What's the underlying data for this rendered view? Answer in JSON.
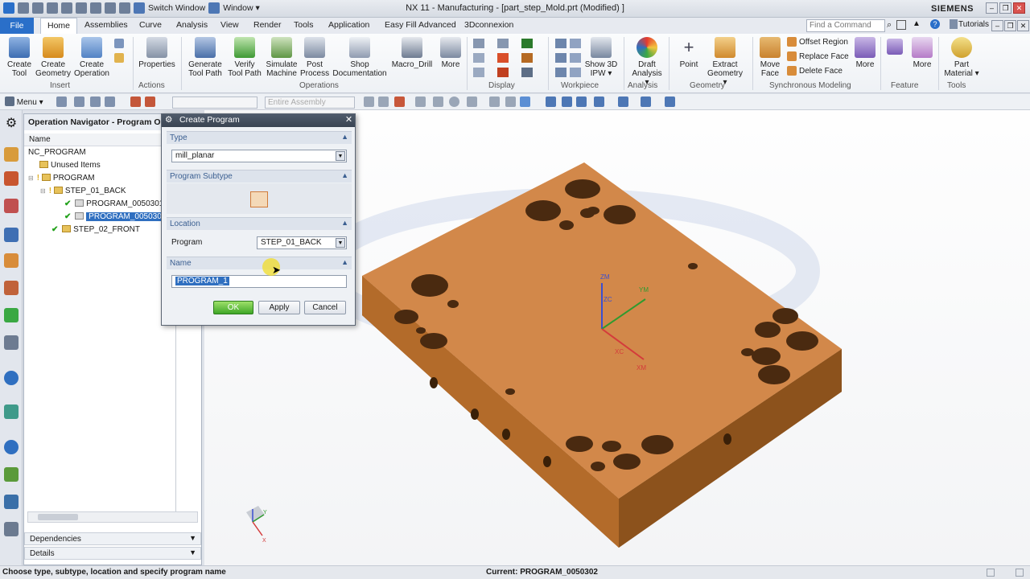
{
  "window": {
    "title": "NX 11 - Manufacturing - [part_step_Mold.prt (Modified) ]",
    "switch_window": "Switch Window",
    "window_menu": "Window ▾",
    "brand": "SIEMENS",
    "search_placeholder": "Find a Command",
    "tutorials": "Tutorials"
  },
  "tabs": [
    "File",
    "Home",
    "Assemblies",
    "Curve",
    "Analysis",
    "View",
    "Render",
    "Tools",
    "Application",
    "Easy Fill Advanced",
    "3Dconnexion"
  ],
  "ribbon": {
    "create_tool": [
      "Create",
      "Tool"
    ],
    "create_geometry": [
      "Create",
      "Geometry"
    ],
    "create_operation": [
      "Create",
      "Operation"
    ],
    "insert": "Insert",
    "properties": "Properties",
    "actions": "Actions",
    "generate_tool_path": [
      "Generate",
      "Tool Path"
    ],
    "verify_tool_path": [
      "Verify",
      "Tool Path"
    ],
    "simulate_machine": [
      "Simulate",
      "Machine"
    ],
    "post_process": [
      "Post",
      "Process"
    ],
    "shop_documentation": [
      "Shop",
      "Documentation"
    ],
    "operations": "Operations",
    "macro_drill": "Macro_Drill",
    "more1": "More",
    "display": "Display",
    "show_3d_ipw": [
      "Show 3D",
      "IPW ▾"
    ],
    "workpiece": "Workpiece",
    "draft_analysis": [
      "Draft",
      "Analysis ▾"
    ],
    "analysis": "Analysis",
    "point": "Point",
    "extract_geometry": [
      "Extract",
      "Geometry ▾"
    ],
    "geometry": "Geometry",
    "move_face": [
      "Move",
      "Face"
    ],
    "offset_region": "Offset Region",
    "replace_face": "Replace Face",
    "delete_face": "Delete Face",
    "more2": "More",
    "synchronous_modeling": "Synchronous Modeling",
    "feature": "Feature",
    "more3": "More",
    "part_material": [
      "Part",
      "Material ▾"
    ],
    "tools": "Tools"
  },
  "toolbar2": {
    "menu": "Menu ▾",
    "filter_placeholder": "Entire Assembly"
  },
  "navigator": {
    "title": "Operation Navigator - Program Order",
    "column": "Name",
    "rows": [
      {
        "label": "NC_PROGRAM"
      },
      {
        "label": "Unused Items"
      },
      {
        "label": "PROGRAM"
      },
      {
        "label": "STEP_01_BACK"
      },
      {
        "label": "PROGRAM_0050301"
      },
      {
        "label": "PROGRAM_0050302"
      },
      {
        "label": "STEP_02_FRONT"
      }
    ],
    "dependencies": "Dependencies",
    "details": "Details"
  },
  "dialog": {
    "title": "Create Program",
    "type_section": "Type",
    "type_value": "mill_planar",
    "subtype_section": "Program Subtype",
    "location_section": "Location",
    "program_label": "Program",
    "program_value": "STEP_01_BACK",
    "name_section": "Name",
    "name_value": "PROGRAM_1",
    "ok": "OK",
    "apply": "Apply",
    "cancel": "Cancel"
  },
  "axes": {
    "zm": "ZM",
    "ym": "YM",
    "zc": "ZC",
    "xc": "XC",
    "xm": "XM",
    "y": "Y",
    "x": "X"
  },
  "status": {
    "hint": "Choose type, subtype, location and specify program name",
    "current": "Current: PROGRAM_0050302"
  },
  "colors": {
    "accent": "#2a6fc9",
    "part": "#c97a33",
    "selection": "#2f6fc0"
  }
}
